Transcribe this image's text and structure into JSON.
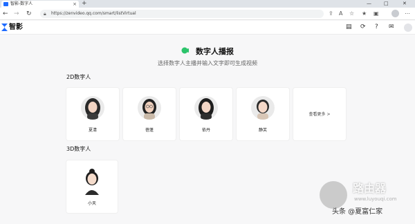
{
  "browser": {
    "tab_title": "智影-数字人",
    "url": "https://zenvideo.qq.com/smart/listVirtual",
    "new_tab": "+",
    "tab_close": "×",
    "window_controls": [
      "—",
      "□",
      "✕"
    ]
  },
  "app": {
    "name": "智影",
    "brand_color": "#1e6bff"
  },
  "page": {
    "title": "数字人播报",
    "subtitle": "选择数字人主播并输入文字即可生成视频"
  },
  "section_2d": {
    "label": "2D数字人",
    "cards": [
      {
        "name": "夏清"
      },
      {
        "name": "蓓蓬"
      },
      {
        "name": "依丹"
      },
      {
        "name": "静芙"
      }
    ],
    "more_label": "查看更多 >"
  },
  "section_3d": {
    "label": "3D数字人",
    "cards": [
      {
        "name": "小天"
      }
    ]
  },
  "watermark": {
    "router": "路由器",
    "site": "www.luyouqi.com",
    "author": "头条 @夏富仁家"
  },
  "icons": [
    "back-icon",
    "forward-icon",
    "refresh-icon",
    "lock-icon",
    "read-aloud-icon",
    "favorite-icon",
    "collections-icon",
    "clipboard-icon",
    "sync-icon",
    "help-icon",
    "message-icon",
    "avatar-icon"
  ]
}
